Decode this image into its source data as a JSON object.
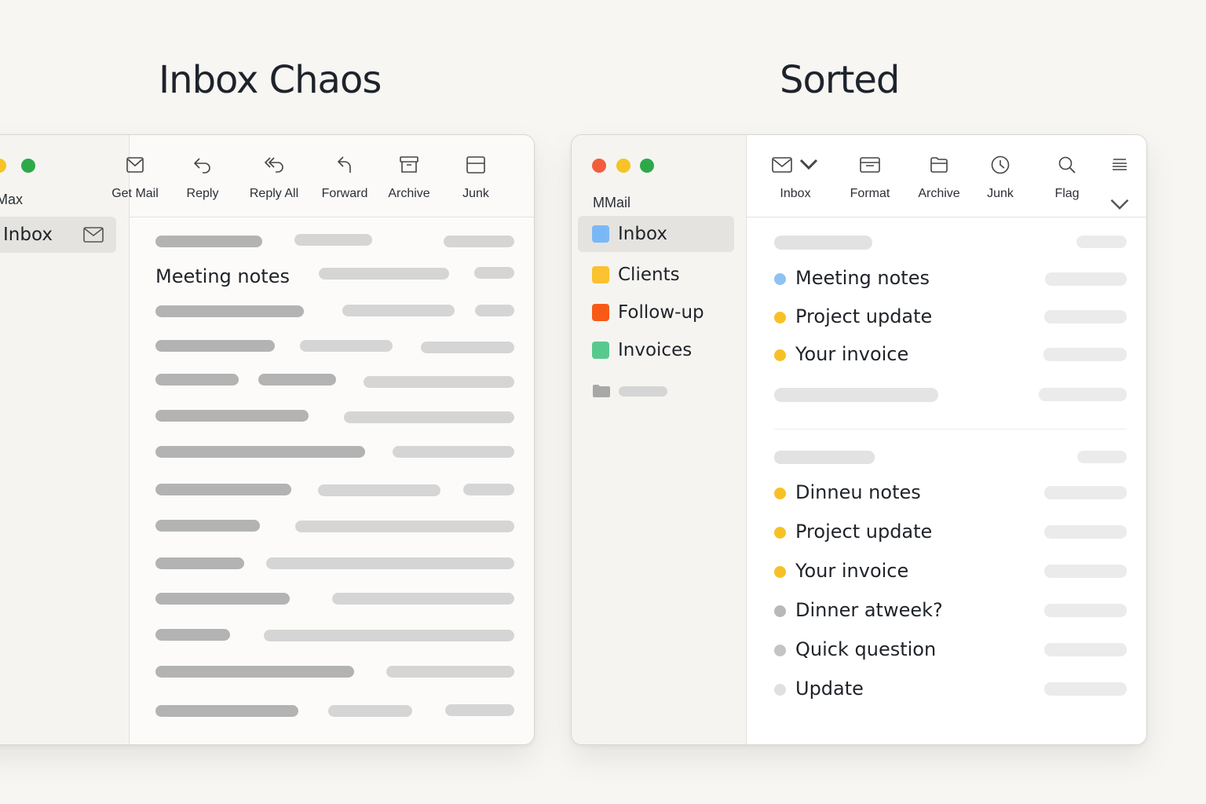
{
  "titles": {
    "left": "Inbox Chaos",
    "right": "Sorted"
  },
  "left_window": {
    "account": "Max",
    "sidebar_inbox": "Inbox",
    "toolbar": [
      "Get Mail",
      "Reply",
      "Reply All",
      "Forward",
      "Archive",
      "Junk"
    ],
    "message_subject": "Meeting notes"
  },
  "right_window": {
    "account": "MMail",
    "mailboxes": [
      {
        "label": "Inbox",
        "color": "#7ab8f5"
      },
      {
        "label": "Clients",
        "color": "#f9c22e"
      },
      {
        "label": "Follow-up",
        "color": "#f85a16"
      },
      {
        "label": "Invoices",
        "color": "#58c98e"
      }
    ],
    "toolbar": [
      "Inbox",
      "Format",
      "Archive",
      "Junk",
      "Flag"
    ],
    "group1": [
      {
        "subject": "Meeting notes",
        "dot": "#8ec2f2"
      },
      {
        "subject": "Project update",
        "dot": "#f7c125"
      },
      {
        "subject": "Your invoice",
        "dot": "#f7c125"
      }
    ],
    "group2": [
      {
        "subject": "Dinneu notes",
        "dot": "#f7c125"
      },
      {
        "subject": "Project update",
        "dot": "#f7c125"
      },
      {
        "subject": "Your invoice",
        "dot": "#f7c125"
      },
      {
        "subject": "Dinner atweek?",
        "dot": "#b9b9b9"
      },
      {
        "subject": "Quick question",
        "dot": "#c4c4c4"
      },
      {
        "subject": "Update",
        "dot": "#e0e0e0"
      }
    ]
  }
}
